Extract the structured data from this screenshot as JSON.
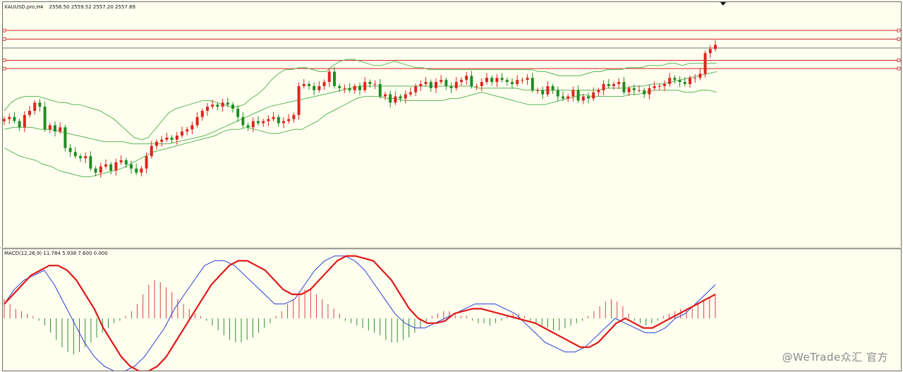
{
  "chart": {
    "title": "XAUUSD.pro,H4",
    "ohlc_readout": "2558.50 2559.52 2557.20 2557.69",
    "macd_label": "MACD(12,26,9) 11.784 5.938 7.600 0.000"
  },
  "watermark": "@WeTrade众汇 官方",
  "colors": {
    "background": "#fffff0",
    "bull_candle": "#e0231c",
    "bear_candle": "#1f8c1f",
    "bands": "#5ab55a",
    "hlines": "#d02020",
    "gray_line": "#707070",
    "macd_line": "#2a3cd8",
    "signal_line": "#e01818",
    "hist_up": "#d84040",
    "hist_down": "#2e8e2e"
  },
  "chart_data": [
    {
      "type": "candlestick",
      "title": "XAUUSD.pro,H4",
      "price_range": [
        0,
        100
      ],
      "horizontal_levels": [
        {
          "value": 89,
          "color": "red"
        },
        {
          "value": 84.8,
          "color": "red"
        },
        {
          "value": 80.5,
          "color": "gray"
        },
        {
          "value": 74.5,
          "color": "red"
        },
        {
          "value": 70.5,
          "color": "red"
        }
      ],
      "close": [
        46,
        47,
        45,
        42,
        48,
        50,
        54,
        52,
        41,
        43,
        40,
        42,
        32,
        30,
        28,
        27,
        28,
        22,
        20,
        23,
        24,
        21,
        25,
        26,
        24,
        22,
        20,
        22,
        28,
        33,
        35,
        36,
        37,
        36,
        38,
        40,
        41,
        43,
        47,
        50,
        52,
        53,
        52,
        54,
        53,
        51,
        47,
        43,
        42,
        45,
        44,
        45,
        46,
        47,
        44,
        45,
        46,
        48,
        62,
        63,
        62,
        60,
        62,
        64,
        69,
        62,
        61,
        61,
        60,
        62,
        60,
        64,
        63,
        63,
        57,
        58,
        54,
        57,
        56,
        58,
        59,
        62,
        63,
        64,
        61,
        64,
        65,
        62,
        61,
        64,
        65,
        67,
        62,
        62,
        64,
        66,
        64,
        66,
        65,
        64,
        63,
        65,
        65,
        66,
        60,
        60,
        58,
        62,
        60,
        57,
        56,
        57,
        60,
        55,
        57,
        56,
        59,
        60,
        63,
        62,
        63,
        64,
        59,
        61,
        60,
        60,
        58,
        61,
        62,
        62,
        63,
        66,
        65,
        64,
        63,
        66,
        66,
        68,
        78,
        80,
        82
      ],
      "bands": {
        "upper": [
          50,
          54,
          56,
          57,
          57,
          57,
          56,
          55,
          54,
          54,
          53,
          53,
          52,
          51,
          50,
          48,
          46,
          43,
          40,
          37,
          36,
          37,
          41,
          45,
          49,
          51,
          52,
          53,
          54,
          55,
          55,
          54,
          53,
          52,
          52,
          53,
          56,
          58,
          61,
          65,
          68,
          70,
          70,
          71,
          71,
          70,
          69,
          69,
          72,
          74,
          75,
          75,
          74,
          73,
          72,
          72,
          73,
          74,
          73,
          72,
          71,
          71,
          70,
          70,
          70,
          70,
          70,
          70,
          70,
          70,
          70,
          70,
          70,
          70,
          70,
          70,
          70,
          70,
          69,
          69,
          68,
          67,
          67,
          67,
          67,
          68,
          69,
          69,
          70,
          70,
          70,
          71,
          71,
          71,
          72,
          72,
          72,
          73,
          73,
          72,
          73,
          73,
          73,
          73,
          73
        ],
        "lower": [
          32,
          30,
          28,
          27,
          26,
          24,
          23,
          21,
          20,
          19,
          18,
          18,
          19,
          20,
          21,
          22,
          24,
          26,
          28,
          30,
          31,
          32,
          33,
          34,
          35,
          36,
          37,
          38,
          40,
          41,
          41,
          42,
          41,
          40,
          39,
          39,
          40,
          41,
          41,
          43,
          45,
          48,
          50,
          52,
          54,
          56,
          57,
          57,
          57,
          56,
          56,
          55,
          55,
          55,
          55,
          55,
          55,
          56,
          56,
          57,
          58,
          59,
          58,
          57,
          56,
          55,
          54,
          53,
          53,
          53,
          54,
          55,
          56,
          57,
          58,
          57,
          57,
          57,
          57,
          57,
          58,
          58,
          59,
          60,
          60,
          60,
          60,
          59,
          59,
          60,
          60,
          59
        ],
        "middle": [
          41,
          42,
          42,
          42,
          41,
          41,
          40,
          39,
          38,
          37,
          36,
          35,
          35,
          35,
          34,
          34,
          34,
          34,
          34,
          35,
          36,
          37,
          38,
          40,
          42,
          44,
          46,
          48,
          50,
          52,
          53,
          54,
          55,
          56,
          57,
          58,
          59,
          60,
          61,
          62,
          62,
          62,
          62,
          62,
          62,
          62,
          62,
          62,
          62,
          62,
          62,
          62,
          61,
          61,
          61,
          61,
          61,
          60,
          60,
          60,
          60,
          60,
          60,
          60,
          60,
          60,
          61,
          61,
          61,
          62,
          62,
          63,
          63,
          64,
          65,
          66,
          67,
          68,
          69
        ]
      }
    },
    {
      "type": "macd",
      "title": "MACD(12,26,9) 11.784 5.938 7.600 0.000",
      "histogram": [
        8,
        6,
        4,
        3,
        2,
        1,
        -1,
        -3,
        -6,
        -9,
        -12,
        -14,
        -15,
        -14,
        -12,
        -10,
        -8,
        -6,
        -4,
        -2,
        -1,
        1,
        3,
        6,
        10,
        14,
        16,
        15,
        13,
        11,
        8,
        6,
        4,
        2,
        1,
        -1,
        -3,
        -5,
        -7,
        -9,
        -10,
        -10,
        -9,
        -8,
        -6,
        -4,
        -2,
        1,
        3,
        6,
        8,
        11,
        12,
        12,
        10,
        8,
        6,
        4,
        2,
        -1,
        -2,
        -3,
        -4,
        -5,
        -6,
        -7,
        -9,
        -10,
        -10,
        -9,
        -8,
        -6,
        -4,
        -2,
        1,
        2,
        3,
        3,
        2,
        1,
        1,
        -1,
        -2,
        -2,
        -3,
        -2,
        -1,
        1,
        2,
        2,
        1,
        -1,
        -2,
        -3,
        -4,
        -5,
        -5,
        -4,
        -3,
        -2,
        -1,
        1,
        3,
        5,
        7,
        8,
        7,
        5,
        2,
        -1,
        -2,
        -3,
        -2,
        -1,
        1,
        2,
        3,
        4,
        4,
        5,
        6,
        8,
        9,
        10
      ],
      "macd_line": [
        6,
        12,
        16,
        18,
        20,
        14,
        6,
        -2,
        -10,
        -16,
        -20,
        -22,
        -22,
        -20,
        -16,
        -10,
        -4,
        4,
        10,
        16,
        22,
        24,
        24,
        22,
        18,
        14,
        10,
        6,
        6,
        8,
        14,
        20,
        24,
        26,
        26,
        24,
        20,
        14,
        8,
        2,
        -2,
        -4,
        -4,
        -2,
        0,
        2,
        4,
        6,
        6,
        6,
        4,
        2,
        -2,
        -6,
        -10,
        -12,
        -14,
        -14,
        -12,
        -8,
        -4,
        0,
        -2,
        -4,
        -6,
        -6,
        -4,
        0,
        2,
        6,
        10,
        14
      ],
      "signal_line": [
        6,
        10,
        14,
        18,
        20,
        22,
        22,
        20,
        16,
        10,
        4,
        -4,
        -10,
        -16,
        -20,
        -22,
        -22,
        -20,
        -16,
        -10,
        -4,
        2,
        8,
        14,
        18,
        22,
        24,
        24,
        22,
        20,
        16,
        12,
        10,
        10,
        12,
        16,
        20,
        24,
        26,
        26,
        25,
        24,
        20,
        16,
        10,
        4,
        0,
        -2,
        -2,
        -1,
        2,
        3,
        4,
        4,
        3,
        2,
        1,
        0,
        -1,
        -2,
        -4,
        -6,
        -8,
        -10,
        -12,
        -12,
        -10,
        -6,
        -2,
        0,
        -2,
        -4,
        -4,
        -2,
        0,
        2,
        4,
        6,
        8,
        10
      ],
      "zero_line": 0
    }
  ]
}
